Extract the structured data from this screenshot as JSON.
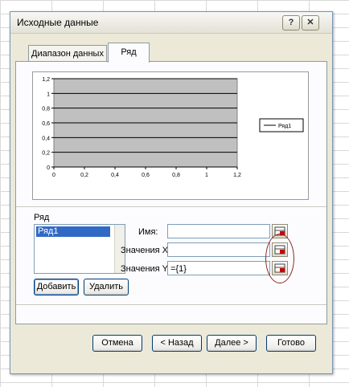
{
  "dialog": {
    "title": "Исходные данные",
    "help_glyph": "?",
    "close_glyph": "✕",
    "tabs": [
      {
        "label": "Диапазон данных",
        "active": false
      },
      {
        "label": "Ряд",
        "active": true
      }
    ]
  },
  "chart_data": {
    "type": "line",
    "x_ticks": [
      "0",
      "0,2",
      "0,4",
      "0,6",
      "0,8",
      "1",
      "1,2"
    ],
    "y_ticks": [
      "0",
      "0,2",
      "0,4",
      "0,6",
      "0,8",
      "1",
      "1,2"
    ],
    "xlim": [
      0,
      1.2
    ],
    "ylim": [
      0,
      1.2
    ],
    "grid": true,
    "plot_area_color": "#c0c0c0",
    "legend_position": "right",
    "series": [
      {
        "name": "Ряд1",
        "x": [],
        "y": []
      }
    ]
  },
  "series_panel": {
    "group_label": "Ряд",
    "list_items": [
      "Ряд1"
    ],
    "add_button": "Добавить",
    "remove_button": "Удалить",
    "name_label": "Имя:",
    "name_value": "",
    "x_label": "Значения X:",
    "x_value": "",
    "y_label": "Значения Y:",
    "y_value": "={1}"
  },
  "buttons": {
    "cancel": "Отмена",
    "back": "< Назад",
    "next": "Далее >",
    "finish": "Готово"
  },
  "colors": {
    "dialog_bg": "#ece9d8",
    "annotation_ellipse": "#8b2a24",
    "selected_item": "#316ac5"
  }
}
